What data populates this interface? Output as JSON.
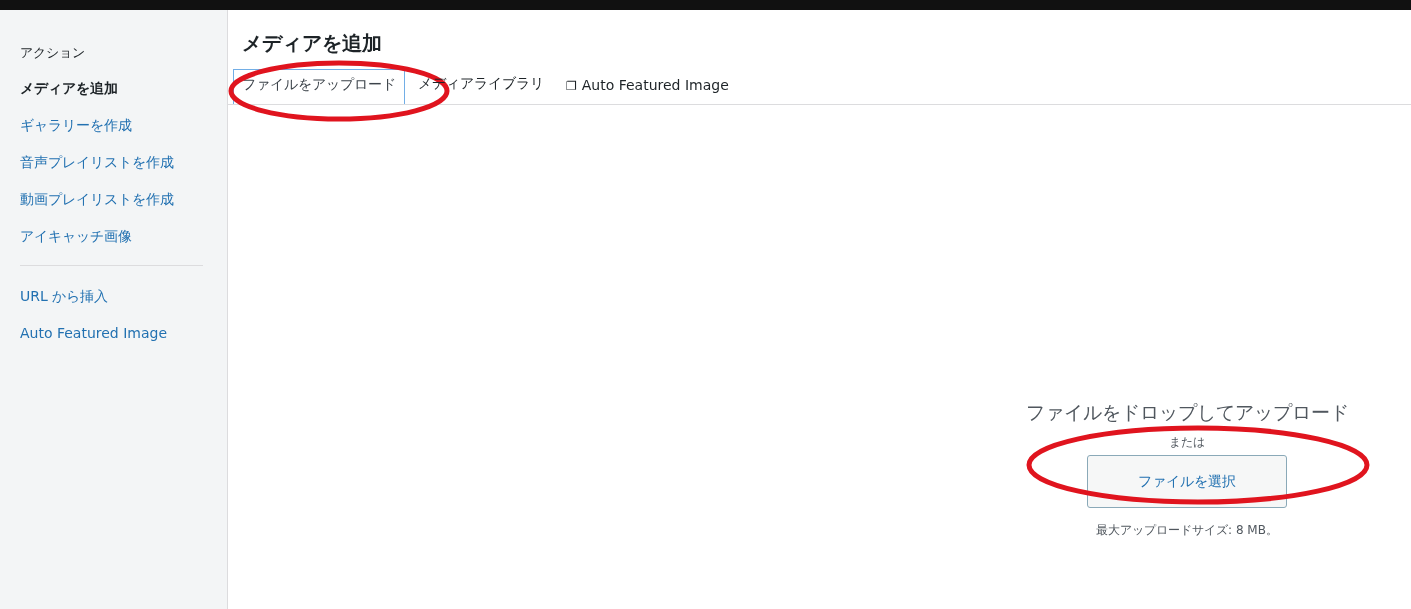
{
  "sidebar": {
    "heading": "アクション",
    "groups": [
      [
        {
          "label": "メディアを追加",
          "selected": true
        },
        {
          "label": "ギャラリーを作成",
          "selected": false
        },
        {
          "label": "音声プレイリストを作成",
          "selected": false
        },
        {
          "label": "動画プレイリストを作成",
          "selected": false
        },
        {
          "label": "アイキャッチ画像",
          "selected": false
        }
      ],
      [
        {
          "label": "URL から挿入",
          "selected": false
        },
        {
          "label": "Auto Featured Image",
          "selected": false
        }
      ]
    ]
  },
  "title": "メディアを追加",
  "tabs": [
    {
      "label": "ファイルをアップロード",
      "selected": true,
      "circled": true
    },
    {
      "label": "メディアライブラリ",
      "selected": false,
      "circled": false
    },
    {
      "glyph": "❐",
      "label": "Auto Featured Image",
      "selected": false,
      "circled": false
    }
  ],
  "uploader": {
    "instructions": "ファイルをドロップしてアップロード",
    "or": "または",
    "button": {
      "label": "ファイルを選択",
      "circled": true
    },
    "max_size": "最大アップロードサイズ: 8 MB。"
  }
}
